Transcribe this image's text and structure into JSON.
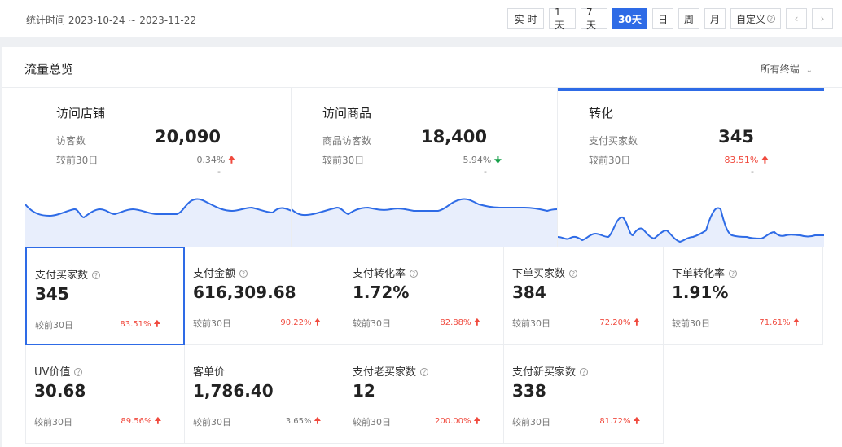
{
  "header": {
    "range_label": "统计时间 2023-10-24 ~ 2023-11-22",
    "buttons": [
      "实 时",
      "1天",
      "7天",
      "30天",
      "日",
      "周",
      "月",
      "自定义"
    ],
    "active": "30天"
  },
  "panel": {
    "title": "流量总览",
    "terminal": "所有终端"
  },
  "top_cards": [
    {
      "title": "访问店铺",
      "label": "访客数",
      "value": "20,090",
      "compare": "较前30日",
      "pct": "0.34%",
      "direction": "up",
      "dash": "-"
    },
    {
      "title": "访问商品",
      "label": "商品访客数",
      "value": "18,400",
      "compare": "较前30日",
      "pct": "5.94%",
      "direction": "down",
      "dash": "-"
    },
    {
      "title": "转化",
      "label": "支付买家数",
      "value": "345",
      "compare": "较前30日",
      "pct": "83.51%",
      "direction": "up",
      "dash": "-"
    }
  ],
  "metrics": [
    {
      "label": "支付买家数",
      "value": "345",
      "compare": "较前30日",
      "pct": "83.51%"
    },
    {
      "label": "支付金额",
      "value": "616,309.68",
      "compare": "较前30日",
      "pct": "90.22%"
    },
    {
      "label": "支付转化率",
      "value": "1.72%",
      "compare": "较前30日",
      "pct": "82.88%"
    },
    {
      "label": "下单买家数",
      "value": "384",
      "compare": "较前30日",
      "pct": "72.20%"
    },
    {
      "label": "下单转化率",
      "value": "1.91%",
      "compare": "较前30日",
      "pct": "71.61%"
    },
    {
      "label": "UV价值",
      "value": "30.68",
      "compare": "较前30日",
      "pct": "89.56%"
    },
    {
      "label": "客单价",
      "value": "1,786.40",
      "compare": "较前30日",
      "pct": "3.65%"
    },
    {
      "label": "支付老买家数",
      "value": "12",
      "compare": "较前30日",
      "pct": "200.00%"
    },
    {
      "label": "支付新买家数",
      "value": "338",
      "compare": "较前30日",
      "pct": "81.72%"
    }
  ],
  "colors": {
    "accent": "#2e6be6",
    "up": "#f04a3e",
    "down": "#17a04a"
  }
}
